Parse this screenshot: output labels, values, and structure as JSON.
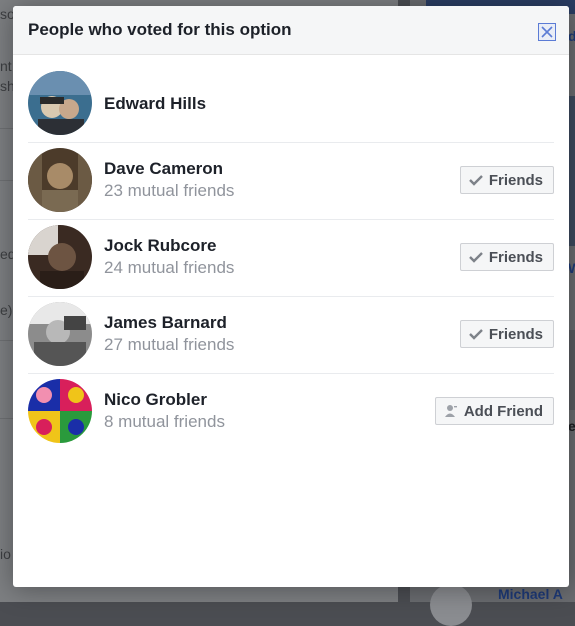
{
  "background": {
    "left_fragments": [
      "so",
      "nt",
      "sh",
      "ed",
      "e)",
      "io"
    ],
    "right_fragments": [
      "d",
      "W",
      "e",
      "Michael A"
    ]
  },
  "modal": {
    "title": "People who voted for this option",
    "close_icon": "close-icon"
  },
  "voters": [
    {
      "name": "Edward Hills",
      "mutual": "",
      "button": "",
      "avatar_colors": [
        "#3b6e8f",
        "#6a8fb0",
        "#d9c9b0"
      ]
    },
    {
      "name": "Dave Cameron",
      "mutual": "23 mutual friends",
      "button": "Friends",
      "button_icon": "checkmark-icon",
      "avatar_colors": [
        "#4c3b2a",
        "#7a6a52",
        "#a88b68"
      ]
    },
    {
      "name": "Jock Rubcore",
      "mutual": "24 mutual friends",
      "button": "Friends",
      "button_icon": "checkmark-icon",
      "avatar_colors": [
        "#3a2a22",
        "#6d5442",
        "#d9d4cf"
      ]
    },
    {
      "name": "James Barnard",
      "mutual": "27 mutual friends",
      "button": "Friends",
      "button_icon": "checkmark-icon",
      "avatar_colors": [
        "#e8e8e8",
        "#555555",
        "#8c8c8c"
      ]
    },
    {
      "name": "Nico Grobler",
      "mutual": "8 mutual friends",
      "button": "Add Friend",
      "button_icon": "add-friend-icon",
      "avatar_colors": [
        "#1a2ea8",
        "#d81f5b",
        "#f0c419",
        "#2a9a3c"
      ]
    }
  ]
}
